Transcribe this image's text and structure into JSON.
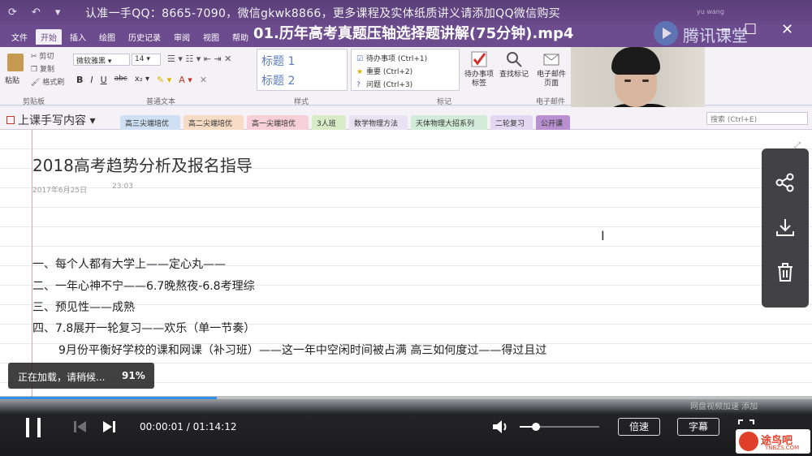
{
  "watermark": "认准一手QQ：8665-7090，微信gkwk8866，更多课程及实体纸质讲义请添加QQ微信购买",
  "video_title": "01.历年高考真题压轴选择题讲解(75分钟).mp4",
  "brand": {
    "name": "腾讯课堂",
    "small": "yu wang"
  },
  "window_controls": {
    "minimize": "—",
    "restore": "☐",
    "close": "✕"
  },
  "ribbon": {
    "tabs": [
      "文件",
      "开始",
      "插入",
      "绘图",
      "历史记录",
      "审阅",
      "视图",
      "帮助"
    ],
    "active_tab": "开始",
    "paste_label": "粘贴",
    "cut": "剪切",
    "copy": "复制",
    "format_painter": "格式刷",
    "clipboard_group": "剪贴板",
    "font_name": "微软雅黑",
    "font_size": "14",
    "basic_text_group": "普通文本",
    "styles": [
      "标题 1",
      "标题 2"
    ],
    "styles_group": "样式",
    "tags": [
      {
        "label": "待办事项 (Ctrl+1)",
        "icon": "checkbox-icon"
      },
      {
        "label": "重要 (Ctrl+2)",
        "icon": "star-icon"
      },
      {
        "label": "问题 (Ctrl+3)",
        "icon": "question-icon"
      }
    ],
    "tags_group": "标记",
    "todo_tag": "待办事项标签",
    "find_tags": "查找标记",
    "email_page": "电子邮件页面",
    "email_group": "电子邮件"
  },
  "notebook": {
    "section_title": "上课手写内容",
    "tabs": [
      {
        "label": "高三尖端培优",
        "color": "#cfe0f5"
      },
      {
        "label": "高二尖端培优",
        "color": "#f7dcc5"
      },
      {
        "label": "高一尖端培优",
        "color": "#f6cfd8"
      },
      {
        "label": "3人班",
        "color": "#d9ecc8"
      },
      {
        "label": "数学物理方法",
        "color": "#e8e3f2"
      },
      {
        "label": "天体物理大招系列",
        "color": "#d3ecd9"
      },
      {
        "label": "二轮复习",
        "color": "#e2d8f1"
      },
      {
        "label": "公开课",
        "color": "#b88fd0"
      }
    ],
    "search_placeholder": "搜索 (Ctrl+E)"
  },
  "page": {
    "title": "2018高考趋势分析及报名指导",
    "date": "2017年6月25日",
    "time": "23:03",
    "lines": [
      "一、每个人都有大学上——定心丸——",
      "二、一年心神不宁——6.7晚熬夜-6.8考理综",
      "三、预见性——成熟",
      "四、7.8展开一轮复习——欢乐（单一节奏）",
      "9月份平衡好学校的课和网课（补习班）——这一年中空闲时间被占满   高三如何度过——得过且过"
    ]
  },
  "toast": {
    "text": "正在加载，请稍候...",
    "percent": "91%"
  },
  "player": {
    "progress": 0.267,
    "current_time": "00:00:01",
    "total_time": "01:14:12",
    "volume": 0.2,
    "speed_label": "倍速",
    "subtitle_label": "字幕",
    "corner_text": "网盘视频加速 添加",
    "accent_color": "#2f8fe6"
  },
  "site_logo": {
    "name": "途鸟吧",
    "domain": "TNBZS.COM"
  }
}
